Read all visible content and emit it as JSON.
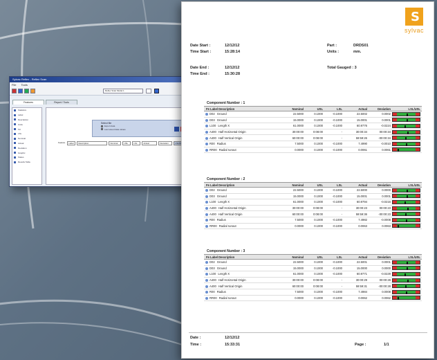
{
  "app": {
    "title": "Sylvac Reflex - Reflex Scan",
    "menu": [
      "File",
      "Tools"
    ],
    "toolbar_select": "Reflex Scan Model 1",
    "tabs": [
      "Features",
      "Report / Tools"
    ],
    "side_items": [
      "Statistics",
      "Label",
      "Description",
      "Units",
      "Tol",
      "LSL",
      "Nominal",
      "Actual",
      "Deviation",
      "Graphic",
      "Status",
      "Results Table"
    ],
    "panel_title": "Select file",
    "panel_options": [
      "Export data",
      "Last saved data values"
    ],
    "filter": [
      "Feature",
      "Label",
      "Description",
      "Nominal",
      "USL",
      "LSL",
      "Actual",
      "Deviation",
      "LSL/MID/USL"
    ]
  },
  "report": {
    "brand": "sylvac",
    "date_start_label": "Date Start :",
    "date_start_value": "12/12/12",
    "time_start_label": "Time Start :",
    "time_start_value": "15:28:14",
    "date_end_label": "Date End :",
    "date_end_value": "12/12/12",
    "time_end_label": "Time End :",
    "time_end_value": "15:30:28",
    "part_label": "Part :",
    "part_value": "DRDS01",
    "units_label": "Units :",
    "units_value": "mm.",
    "total_gauged": "Total Gauged : 3",
    "columns": [
      "Fe Label Description",
      "Nominal",
      "USL",
      "LSL",
      "Actual",
      "Deviation",
      "LSL/USL"
    ],
    "components": [
      {
        "title": "Component Number : 1",
        "rows": [
          {
            "label": "D02",
            "desc": "Ground",
            "nominal": "22.5000",
            "usl": "0.1000",
            "lsl": "-0.1000",
            "actual": "22.5002",
            "deviation": "0.0002",
            "marker": 0.5
          },
          {
            "label": "D03",
            "desc": "Ground",
            "nominal": "15.0000",
            "usl": "0.1000",
            "lsl": "-0.1000",
            "actual": "15.0001",
            "deviation": "0.0001",
            "marker": 0.5
          },
          {
            "label": "L100",
            "desc": "Length X",
            "nominal": "61.0000",
            "usl": "0.1000",
            "lsl": "-0.1000",
            "actual": "60.9776",
            "deviation": "-0.0224",
            "marker": 0.39
          },
          {
            "label": "A400",
            "desc": "Half Horizontal Origin",
            "nominal": "30:00:00",
            "usl": "0:08:00",
            "lsl": "-",
            "actual": "30:00:34",
            "deviation": "00:00:34",
            "marker": 0.55
          },
          {
            "label": "A400",
            "desc": "Half Vertical Origin",
            "nominal": "60:00:00",
            "usl": "0:08:00",
            "lsl": "-",
            "actual": "59:59:26",
            "deviation": "-00:00:34",
            "marker": 0.45
          },
          {
            "label": "R00",
            "desc": "Radius",
            "nominal": "7.5000",
            "usl": "0.1000",
            "lsl": "-0.1000",
            "actual": "7.4990",
            "deviation": "-0.0010",
            "marker": 0.48
          },
          {
            "label": "RR00",
            "desc": "Radial runout",
            "nominal": "0.0000",
            "usl": "0.1000",
            "lsl": "-0.1000",
            "actual": "0.0061",
            "deviation": "0.0061",
            "marker": 0.05
          }
        ]
      },
      {
        "title": "Component Number : 2",
        "rows": [
          {
            "label": "D02",
            "desc": "Ground",
            "nominal": "22.5000",
            "usl": "0.1000",
            "lsl": "-0.1000",
            "actual": "22.5000",
            "deviation": "0.0000",
            "marker": 0.5
          },
          {
            "label": "D03",
            "desc": "Ground",
            "nominal": "15.0000",
            "usl": "0.1000",
            "lsl": "-0.1000",
            "actual": "15.0001",
            "deviation": "0.0001",
            "marker": 0.5
          },
          {
            "label": "L100",
            "desc": "Length X",
            "nominal": "61.0000",
            "usl": "0.1000",
            "lsl": "-0.1000",
            "actual": "60.9794",
            "deviation": "-0.0216",
            "marker": 0.4
          },
          {
            "label": "A400",
            "desc": "Half Horizontal Origin",
            "nominal": "30:00:00",
            "usl": "0:08:00",
            "lsl": "-",
            "actual": "30:00:23",
            "deviation": "00:00:23",
            "marker": 0.54
          },
          {
            "label": "A400",
            "desc": "Half Vertical Origin",
            "nominal": "60:00:00",
            "usl": "0:08:00",
            "lsl": "-",
            "actual": "59:59:36",
            "deviation": "-00:00:23",
            "marker": 0.46
          },
          {
            "label": "R00",
            "desc": "Radius",
            "nominal": "7.5000",
            "usl": "0.1000",
            "lsl": "-0.1000",
            "actual": "7.4982",
            "deviation": "-0.0008",
            "marker": 0.49
          },
          {
            "label": "RR00",
            "desc": "Radial runout",
            "nominal": "0.0000",
            "usl": "0.1000",
            "lsl": "-0.1000",
            "actual": "0.0063",
            "deviation": "0.0063",
            "marker": 0.05
          }
        ]
      },
      {
        "title": "Component Number : 3",
        "rows": [
          {
            "label": "D02",
            "desc": "Ground",
            "nominal": "22.5000",
            "usl": "0.1000",
            "lsl": "-0.1000",
            "actual": "22.5001",
            "deviation": "0.0001",
            "marker": 0.5
          },
          {
            "label": "D03",
            "desc": "Ground",
            "nominal": "15.0000",
            "usl": "0.1000",
            "lsl": "-0.1000",
            "actual": "15.0000",
            "deviation": "0.0000",
            "marker": 0.5
          },
          {
            "label": "L100",
            "desc": "Length X",
            "nominal": "61.0000",
            "usl": "0.1000",
            "lsl": "-0.1000",
            "actual": "60.9771",
            "deviation": "-0.0229",
            "marker": 0.39
          },
          {
            "label": "A400",
            "desc": "Half Horizontal Origin",
            "nominal": "30:00:00",
            "usl": "0:08:00",
            "lsl": "-",
            "actual": "30:00:29",
            "deviation": "00:00:28",
            "marker": 0.55
          },
          {
            "label": "A400",
            "desc": "Half Vertical Origin",
            "nominal": "60:00:00",
            "usl": "0:08:00",
            "lsl": "-",
            "actual": "59:59:31",
            "deviation": "-00:00:28",
            "marker": 0.45
          },
          {
            "label": "R00",
            "desc": "Radius",
            "nominal": "7.5000",
            "usl": "0.1000",
            "lsl": "-0.1000",
            "actual": "7.4984",
            "deviation": "0.0008",
            "marker": 0.49
          },
          {
            "label": "RR00",
            "desc": "Radial runout",
            "nominal": "0.0000",
            "usl": "0.1000",
            "lsl": "-0.1000",
            "actual": "0.0062",
            "deviation": "0.0062",
            "marker": 0.05
          }
        ]
      }
    ],
    "footer_date_label": "Date :",
    "footer_date_value": "12/12/12",
    "footer_time_label": "Time :",
    "footer_time_value": "15:33:31",
    "page_label": "Page :",
    "page_value": "1/1"
  }
}
